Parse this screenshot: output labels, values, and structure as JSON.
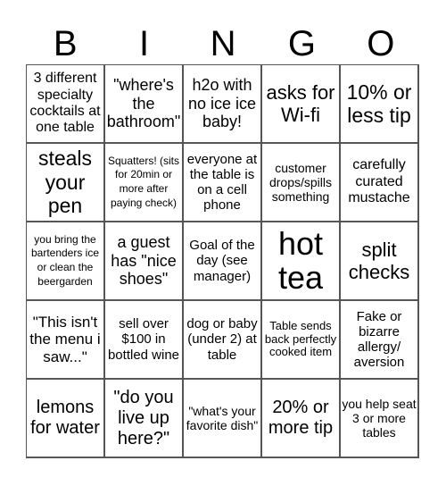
{
  "header": {
    "letters": [
      "B",
      "I",
      "N",
      "G",
      "O"
    ]
  },
  "cells": [
    "3 different specialty cocktails at one table",
    "\"where's the bathroom\"",
    "h2o with no ice ice baby!",
    "asks for Wi-fi",
    "10% or less tip",
    "steals your pen",
    "Squatters! (sits for 20min or more after paying check)",
    "everyone at the table is on a cell phone",
    "customer drops/spills something",
    "carefully curated mustache",
    "you bring the bartenders ice or clean the beergarden",
    "a guest has \"nice shoes\"",
    "Goal of the day (see manager)",
    "hot tea",
    "split checks",
    "\"This isn't the menu i saw...\"",
    "sell over $100 in bottled wine",
    "dog or baby (under 2) at table",
    "Table sends back perfectly cooked item",
    "Fake or bizarre allergy/ aversion",
    "lemons for water",
    "\"do you live up here?\"",
    "\"what's your favorite dish\"",
    "20% or more tip",
    "you help seat 3 or more tables"
  ]
}
